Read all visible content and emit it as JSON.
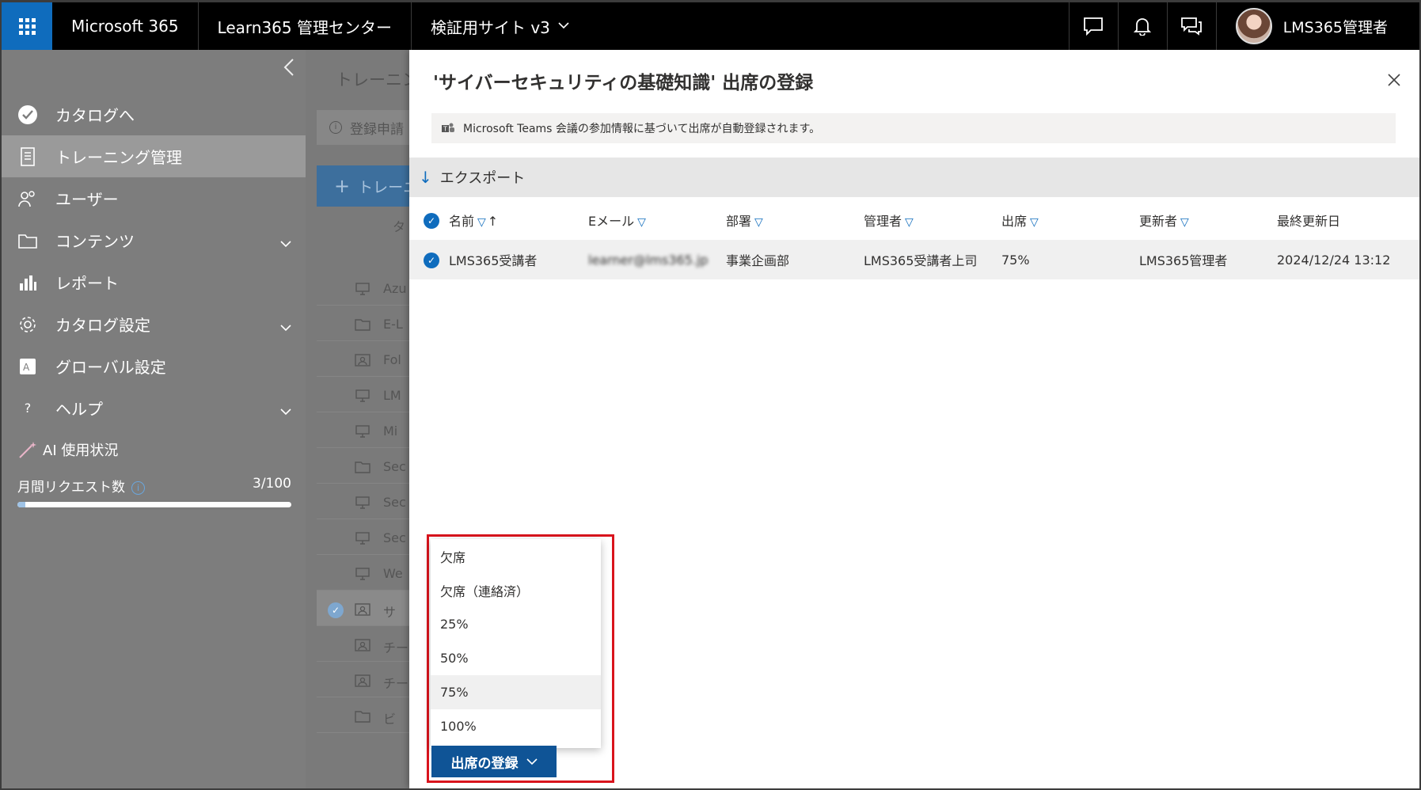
{
  "topbar": {
    "app_name": "Microsoft 365",
    "admin_center": "Learn365 管理センター",
    "site": "検証用サイト v3",
    "user_name": "LMS365管理者"
  },
  "sidebar": {
    "items": [
      {
        "label": "カタログへ"
      },
      {
        "label": "トレーニング管理"
      },
      {
        "label": "ユーザー"
      },
      {
        "label": "コンテンツ"
      },
      {
        "label": "レポート"
      },
      {
        "label": "カタログ設定"
      },
      {
        "label": "グローバル設定"
      },
      {
        "label": "ヘルプ"
      }
    ],
    "ai_usage": {
      "title": "AI 使用状況",
      "request_label": "月間リクエスト数",
      "count": "3/100",
      "fraction": 0.03
    }
  },
  "background": {
    "title": "トレーニン",
    "notice": "登録申請",
    "add_button": "トレーニ",
    "column": "タ",
    "rows": [
      "Azu",
      "E-L",
      "Fol",
      "LM",
      "Mi",
      "Sec",
      "Sec",
      "Sec",
      "We",
      "サ",
      "チー",
      "チー",
      "ビ"
    ]
  },
  "panel": {
    "title": "'サイバーセキュリティの基礎知識' 出席の登録",
    "notice": "Microsoft Teams 会議の参加情報に基づいて出席が自動登録されます。",
    "export_label": "エクスポート",
    "columns": {
      "name": "名前",
      "email": "Eメール",
      "department": "部署",
      "manager": "管理者",
      "attendance": "出席",
      "updated_by": "更新者",
      "last_updated": "最終更新日"
    },
    "rows": [
      {
        "name": "LMS365受講者",
        "email": "learner@lms365.jp",
        "department": "事業企画部",
        "manager": "LMS365受講者上司",
        "attendance": "75%",
        "updated_by": "LMS365管理者",
        "last_updated": "2024/12/24 13:12"
      }
    ],
    "menu_items": [
      "欠席",
      "欠席（連絡済）",
      "25%",
      "50%",
      "75%",
      "100%"
    ],
    "register_button": "出席の登録"
  }
}
